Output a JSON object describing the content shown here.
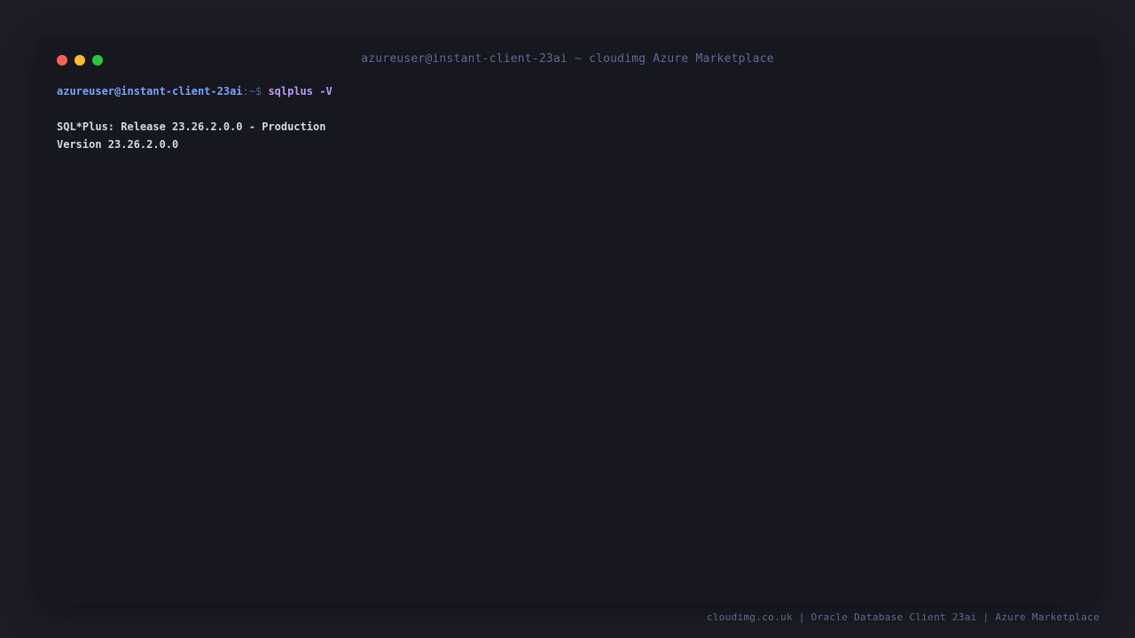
{
  "window": {
    "title": "azureuser@instant-client-23ai ~ cloudimg Azure Marketplace",
    "controls": {
      "close_color": "#ff5f57",
      "minimize_color": "#febc2e",
      "maximize_color": "#28c840"
    }
  },
  "terminal": {
    "prompt_user_host": "azureuser@instant-client-23ai",
    "prompt_path": ":~$",
    "command": "sqlplus -V",
    "output": [
      "SQL*Plus: Release 23.26.2.0.0 - Production",
      "Version 23.26.2.0.0"
    ]
  },
  "footer": {
    "text": "cloudimg.co.uk | Oracle Database Client 23ai | Azure Marketplace"
  },
  "colors": {
    "background": "#1c1d26",
    "terminal_bg": "#16171f",
    "prompt": "#7aa2f7",
    "command": "#bb9af7",
    "output": "#d4d7e6"
  }
}
